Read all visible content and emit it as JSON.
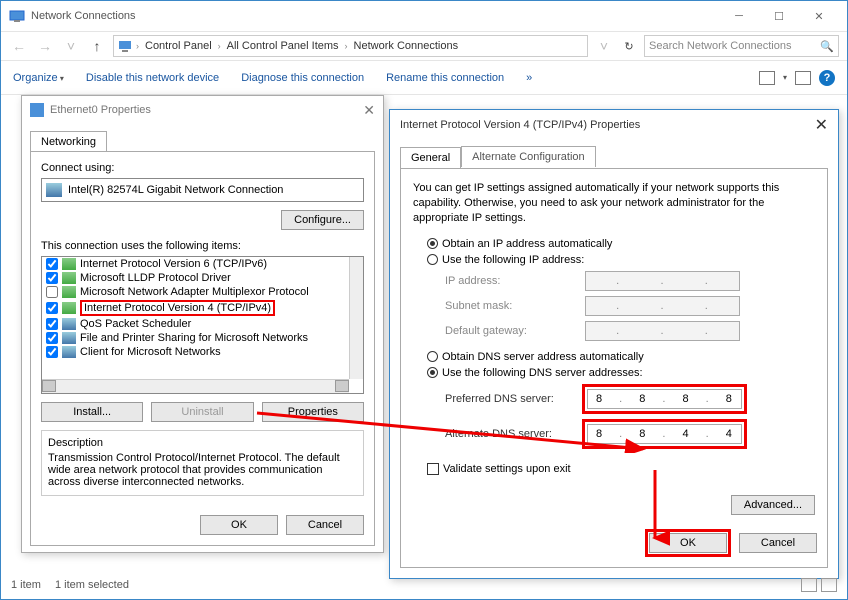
{
  "window": {
    "title": "Network Connections"
  },
  "breadcrumb": {
    "root_icon": "pc-icon",
    "items": [
      "Control Panel",
      "All Control Panel Items",
      "Network Connections"
    ]
  },
  "search": {
    "placeholder": "Search Network Connections"
  },
  "toolbar": {
    "organize": "Organize",
    "disable": "Disable this network device",
    "diagnose": "Diagnose this connection",
    "rename": "Rename this connection",
    "more": "»"
  },
  "dlg1": {
    "title": "Ethernet0 Properties",
    "tab": "Networking",
    "connect_using": "Connect using:",
    "adapter": "Intel(R) 82574L Gigabit Network Connection",
    "configure": "Configure...",
    "uses": "This connection uses the following items:",
    "items": [
      {
        "checked": true,
        "icon": "nic",
        "label": "Client for Microsoft Networks"
      },
      {
        "checked": true,
        "icon": "nic",
        "label": "File and Printer Sharing for Microsoft Networks"
      },
      {
        "checked": true,
        "icon": "nic",
        "label": "QoS Packet Scheduler"
      },
      {
        "checked": true,
        "icon": "proto",
        "label": "Internet Protocol Version 4 (TCP/IPv4)",
        "highlight": true
      },
      {
        "checked": false,
        "icon": "proto",
        "label": "Microsoft Network Adapter Multiplexor Protocol"
      },
      {
        "checked": true,
        "icon": "proto",
        "label": "Microsoft LLDP Protocol Driver"
      },
      {
        "checked": true,
        "icon": "proto",
        "label": "Internet Protocol Version 6 (TCP/IPv6)"
      }
    ],
    "install": "Install...",
    "uninstall": "Uninstall",
    "properties": "Properties",
    "desc_h": "Description",
    "desc_t": "Transmission Control Protocol/Internet Protocol. The default wide area network protocol that provides communication across diverse interconnected networks.",
    "ok": "OK",
    "cancel": "Cancel"
  },
  "dlg2": {
    "title": "Internet Protocol Version 4 (TCP/IPv4) Properties",
    "tab_general": "General",
    "tab_alt": "Alternate Configuration",
    "info": "You can get IP settings assigned automatically if your network supports this capability. Otherwise, you need to ask your network administrator for the appropriate IP settings.",
    "r_auto_ip": "Obtain an IP address automatically",
    "r_static_ip": "Use the following IP address:",
    "f_ip": "IP address:",
    "f_mask": "Subnet mask:",
    "f_gw": "Default gateway:",
    "r_auto_dns": "Obtain DNS server address automatically",
    "r_static_dns": "Use the following DNS server addresses:",
    "f_pref_dns": "Preferred DNS server:",
    "f_alt_dns": "Alternate DNS server:",
    "dns1": [
      "8",
      "8",
      "8",
      "8"
    ],
    "dns2": [
      "8",
      "8",
      "4",
      "4"
    ],
    "validate": "Validate settings upon exit",
    "advanced": "Advanced...",
    "ok": "OK",
    "cancel": "Cancel"
  },
  "status": {
    "count": "1 item",
    "selected": "1 item selected"
  }
}
